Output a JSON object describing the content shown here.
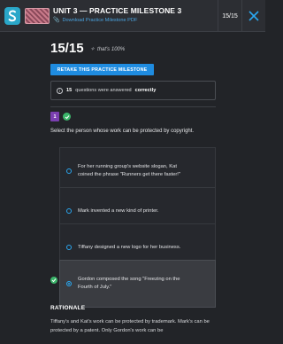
{
  "header": {
    "logo": "sophia-logo-icon",
    "unit_title": "UNIT 3 — PRACTICE MILESTONE 3",
    "pdf_link": "Download Practice Milestone PDF",
    "score": "15/15",
    "close": "close-icon"
  },
  "result": {
    "score": "15/15",
    "praise": "that's 100%",
    "retake_label": "RETAKE THIS PRACTICE MILESTONE",
    "info_count": "15",
    "info_text": "questions were answered",
    "info_bold": "correctly"
  },
  "question": {
    "number": "1",
    "prompt": "Select the person whose work can be protected by copyright.",
    "choices": [
      {
        "text": "For her running group's website slogan, Kat coined the phrase \"Runners get there faster!\"",
        "selected": false
      },
      {
        "text": "Mark invented a new kind of printer.",
        "selected": false
      },
      {
        "text": "Tiffany designed a new logo for her business.",
        "selected": false
      },
      {
        "text": "Gordon composed the song \"Freezing on the Fourth of July.\"",
        "selected": true
      }
    ]
  },
  "rationale": {
    "heading": "RATIONALE",
    "text": "Tiffany's and Kat's work can be protected by trademark. Mark's can be protected by a patent. Only Gordon's work can be"
  },
  "colors": {
    "accent": "#1f8ce0",
    "correct": "#3bb56a",
    "question_badge": "#7a3fb0"
  }
}
